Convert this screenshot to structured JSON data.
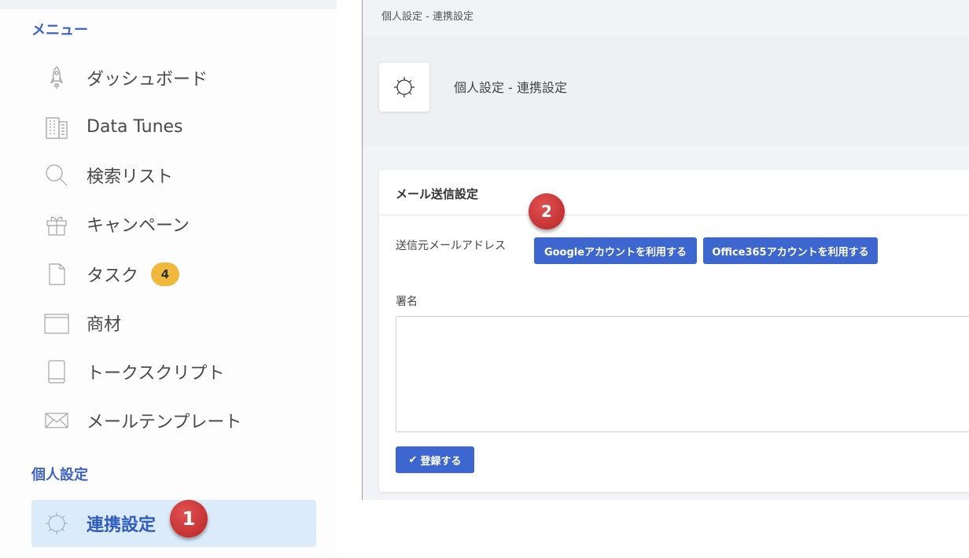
{
  "sidebar": {
    "menu_title": "メニュー",
    "items": [
      {
        "label": "ダッシュボード",
        "icon": "rocket-icon"
      },
      {
        "label": "Data Tunes",
        "icon": "building-icon"
      },
      {
        "label": "検索リスト",
        "icon": "search-icon"
      },
      {
        "label": "キャンペーン",
        "icon": "gift-icon"
      },
      {
        "label": "タスク",
        "icon": "document-icon",
        "badge": "4"
      },
      {
        "label": "商材",
        "icon": "box-icon"
      },
      {
        "label": "トークスクリプト",
        "icon": "book-icon"
      },
      {
        "label": "メールテンプレート",
        "icon": "envelope-icon"
      }
    ],
    "personal_title": "個人設定",
    "active_item": {
      "label": "連携設定",
      "icon": "gear-icon"
    },
    "step_marker": "1"
  },
  "main": {
    "breadcrumb": "個人設定 - 連携設定",
    "page_title": "個人設定 - 連携設定",
    "card": {
      "title": "メール送信設定",
      "step_marker": "2",
      "sender_label": "送信元メールアドレス",
      "google_button": "Googleアカウントを利用する",
      "office_button": "Office365アカウントを利用する",
      "signature_label": "署名",
      "signature_value": "",
      "submit_label": "登録する"
    }
  },
  "colors": {
    "accent": "#3d66cf",
    "section_title": "#3f62c9",
    "active_bg": "#dcebfa",
    "badge": "#f0b93e",
    "marker": "#c62e2e"
  }
}
